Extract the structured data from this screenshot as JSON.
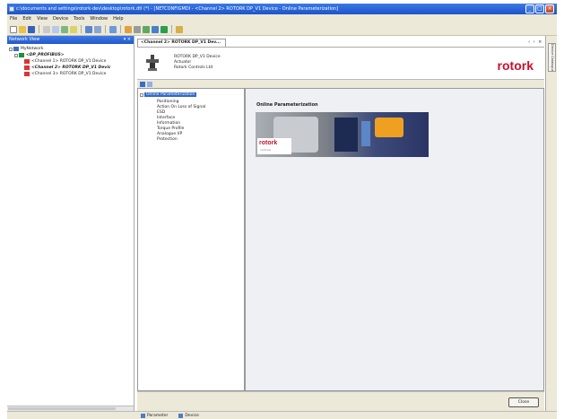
{
  "window": {
    "title": "c:\\documents and settings\\rotork-dev\\desktop\\rotork.dtl (*) - [NETCONFIGMDI - <Channel 2> ROTORK DP_V1 Device - Online Parameterization]",
    "controls": [
      "minimize-icon",
      "maximize-icon",
      "close-icon"
    ]
  },
  "menu": [
    "File",
    "Edit",
    "View",
    "Device",
    "Tools",
    "Window",
    "Help"
  ],
  "left_panel": {
    "title": "Network View",
    "tree": [
      {
        "label": "MyNetwork",
        "icon": "network-icon",
        "style": "normal"
      },
      {
        "label": "<DP_PROFIBUS>",
        "icon": "dp-master-icon",
        "style": "bold"
      },
      {
        "label": "<Channel 1> ROTORK DP_V1 Device",
        "icon": "device-icon",
        "style": "normal"
      },
      {
        "label": "<Channel 2> ROTORK DP_V1 Devic",
        "icon": "device-icon",
        "style": "bold"
      },
      {
        "label": "<Channel 3> ROTORK DP_V1 Device",
        "icon": "device-icon",
        "style": "normal"
      }
    ]
  },
  "doc_tab": {
    "label": "<Channel 2> ROTORK DP_V1 Dev...",
    "controls": "‹ › ×"
  },
  "device_header": {
    "device_name": "ROTORK DP_V1 Device",
    "device_type": "Actuator",
    "vendor": "Rotork Controls Ltd",
    "brand": "rotork"
  },
  "nav_tree": {
    "root": "Online Parameterization",
    "items": [
      "Positioning",
      "Action On Loss of Signal",
      "ESD",
      "Interface",
      "Information",
      "Torque Profile",
      "Analogue I/P",
      "Protection"
    ]
  },
  "content": {
    "title": "Online Parameterization",
    "banner_logo": "rotork",
    "banner_logo_sub": "controls"
  },
  "footer": {
    "close_label": "Close"
  },
  "right_strip": {
    "tab_label": "Device Catalogue"
  },
  "bottom_tabs": [
    "Parameter",
    "Device"
  ]
}
